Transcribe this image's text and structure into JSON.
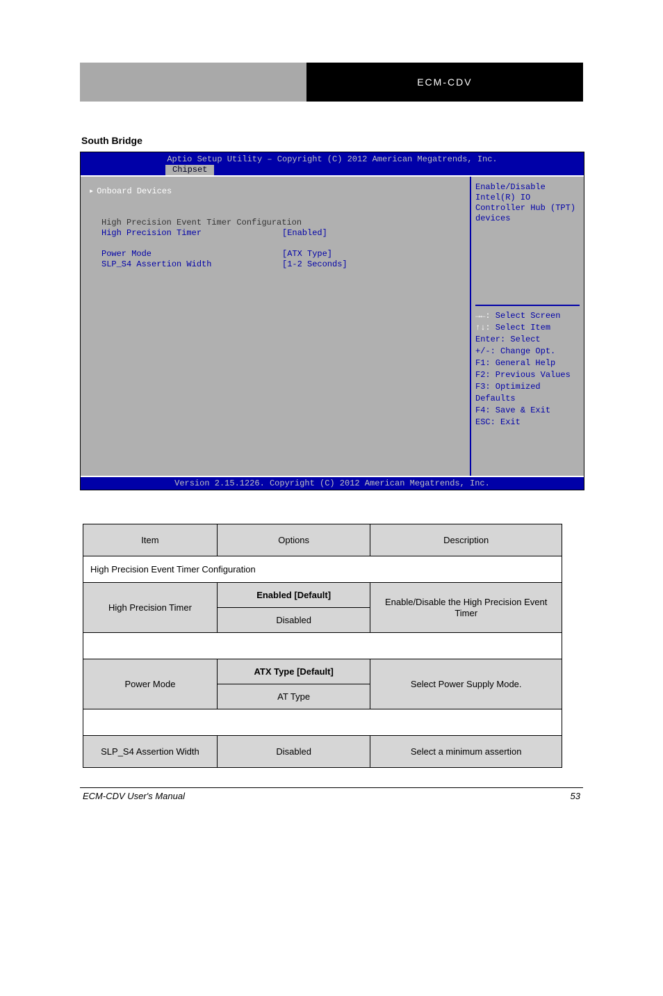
{
  "header": {
    "right_text": "ECM-CDV"
  },
  "section_title": "South Bridge",
  "bios": {
    "title_line": "Aptio Setup Utility – Copyright (C) 2012 American Megatrends, Inc.",
    "tab": "Chipset",
    "rows": {
      "onboard": "Onboard Devices",
      "hpet_heading": "High Precision Event Timer Configuration",
      "hpet_label": "High Precision Timer",
      "hpet_value": "[Enabled]",
      "power_label": "Power Mode",
      "power_value": "[ATX Type]",
      "slp_label": "SLP_S4 Assertion Width",
      "slp_value": "[1-2 Seconds]"
    },
    "help": {
      "line1": "Enable/Disable Intel(R) IO",
      "line2": "Controller Hub (TPT) devices"
    },
    "keys": [
      {
        "sym": "→←:",
        "txt": " Select Screen"
      },
      {
        "sym": "↑↓:",
        "txt": " Select Item"
      },
      {
        "sym": "Enter:",
        "txt": " Select"
      },
      {
        "sym": "+/-:",
        "txt": " Change Opt."
      },
      {
        "sym": "F1:",
        "txt": " General Help"
      },
      {
        "sym": "F2:",
        "txt": " Previous Values"
      },
      {
        "sym": "F3:",
        "txt": " Optimized Defaults"
      },
      {
        "sym": "F4:",
        "txt": " Save & Exit"
      },
      {
        "sym": "ESC:",
        "txt": " Exit"
      }
    ],
    "bottom": "Version 2.15.1226. Copyright (C) 2012 American Megatrends, Inc."
  },
  "table": {
    "hdr": {
      "item": "Item",
      "options": "Options",
      "desc": "Description"
    },
    "hpet_section": "High Precision Event Timer Configuration",
    "hpet": {
      "item": "High Precision Timer",
      "opt1": "Enabled [Default]",
      "opt2": "Disabled",
      "desc": "Enable/Disable the High Precision Event Timer"
    },
    "br1": "",
    "power": {
      "item": "Power Mode",
      "opt1": "ATX Type [Default]",
      "opt2": "AT Type",
      "desc": "Select Power Supply Mode."
    },
    "br2": "",
    "slp": {
      "item": "SLP_S4 Assertion Width",
      "opt": "Disabled",
      "desc": "Select a minimum assertion"
    }
  },
  "footer": {
    "left": "ECM-CDV User's Manual",
    "right": "53"
  }
}
